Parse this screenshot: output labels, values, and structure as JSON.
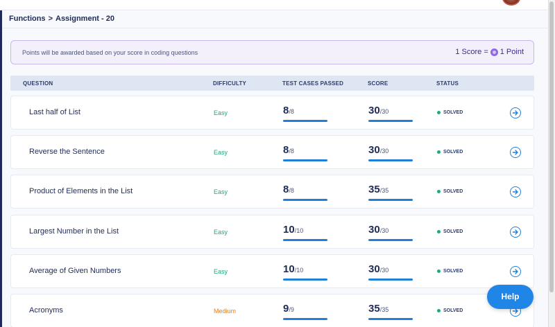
{
  "breadcrumb": {
    "section": "Functions",
    "separator": ">",
    "page": "Assignment - 20"
  },
  "banner": {
    "text": "Points will be awarded based on your score in coding questions",
    "score_rule_left": "1 Score =",
    "score_rule_right": "1 Point"
  },
  "table": {
    "headers": [
      "QUESTION",
      "DIFFICULTY",
      "TEST CASES PASSED",
      "SCORE",
      "STATUS"
    ],
    "rows": [
      {
        "question": "Last half of List",
        "difficulty": "Easy",
        "tests_passed": "8",
        "tests_total": "/8",
        "score": "30",
        "score_total": "/30",
        "status": "SOLVED"
      },
      {
        "question": "Reverse the Sentence",
        "difficulty": "Easy",
        "tests_passed": "8",
        "tests_total": "/8",
        "score": "30",
        "score_total": "/30",
        "status": "SOLVED"
      },
      {
        "question": "Product of Elements in the List",
        "difficulty": "Easy",
        "tests_passed": "8",
        "tests_total": "/8",
        "score": "35",
        "score_total": "/35",
        "status": "SOLVED"
      },
      {
        "question": "Largest Number in the List",
        "difficulty": "Easy",
        "tests_passed": "10",
        "tests_total": "/10",
        "score": "30",
        "score_total": "/30",
        "status": "SOLVED"
      },
      {
        "question": "Average of Given Numbers",
        "difficulty": "Easy",
        "tests_passed": "10",
        "tests_total": "/10",
        "score": "30",
        "score_total": "/30",
        "status": "SOLVED"
      },
      {
        "question": "Acronyms",
        "difficulty": "Medium",
        "tests_passed": "9",
        "tests_total": "/9",
        "score": "35",
        "score_total": "/35",
        "status": "SOLVED"
      }
    ]
  },
  "help": {
    "label": "Help"
  },
  "colors": {
    "accent": "#1f85e6",
    "easy": "#1fa97a",
    "medium": "#f07b12",
    "banner_border": "#c9b6ea"
  },
  "icons": {
    "row_action": "arrow-right-circle-icon",
    "coin": "coin-icon",
    "avatar": "avatar"
  }
}
